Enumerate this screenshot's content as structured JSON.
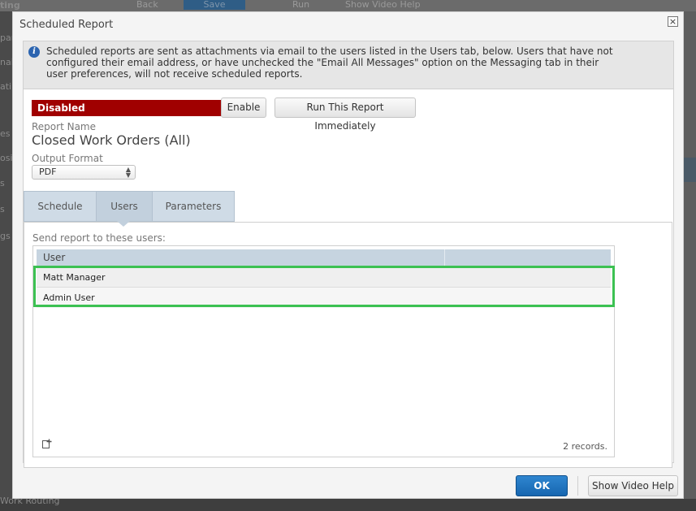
{
  "background": {
    "toolbar": [
      "Back",
      "Save",
      "Run",
      "Show Video Help"
    ],
    "sidebar_fragments": [
      "ting",
      "pan",
      "nai",
      "ati",
      "es",
      "osin",
      "s",
      "s",
      "gs"
    ],
    "bottom_text": "Work Routing"
  },
  "dialog": {
    "title": "Scheduled Report",
    "close_glyph": "×",
    "info_icon": "i",
    "info_text": "Scheduled reports are sent as attachments via email to the users listed in the Users tab, below. Users that have not configured their email address, or have unchecked the \"Email All Messages\" option on the Messaging tab in their user preferences, will not receive scheduled reports.",
    "status": "Disabled",
    "enable_label": "Enable",
    "run_label": "Run This Report Immediately",
    "report_name_label": "Report Name",
    "report_name": "Closed Work Orders (All)",
    "output_format_label": "Output Format",
    "output_format": "PDF",
    "tabs": [
      "Schedule",
      "Users",
      "Parameters"
    ],
    "panel_label": "Send report to these users:",
    "grid": {
      "columns": [
        "User",
        ""
      ],
      "rows": [
        "Matt Manager",
        "Admin User"
      ],
      "records": "2 records."
    },
    "ok_label": "OK",
    "help_label": "Show Video Help"
  },
  "colors": {
    "disabled": "#a00000",
    "highlight": "#3cc152",
    "primary": "#1f74c0",
    "tab": "#c2d0dd"
  },
  "icons": {
    "close": "close-icon",
    "info": "info-icon",
    "add": "add-record-icon",
    "select": "chevron-updown-icon"
  }
}
